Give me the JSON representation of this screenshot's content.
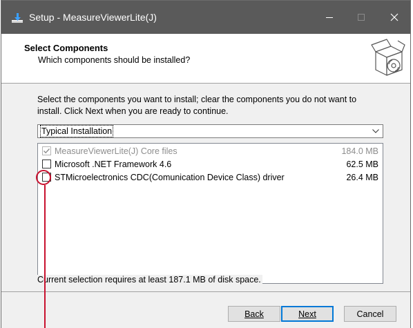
{
  "window": {
    "title": "Setup - MeasureViewerLite(J)",
    "icons": {
      "app": "installer-icon",
      "minimize": "minimize-icon",
      "maximize": "maximize-icon",
      "close": "close-icon"
    }
  },
  "header": {
    "title": "Select Components",
    "subtitle": "Which components should be installed?",
    "art": "software-box-icon"
  },
  "instructions": "Select the components you want to install; clear the components you do not want to install. Click Next when you are ready to continue.",
  "install_type": {
    "selected": "Typical Installation"
  },
  "components": [
    {
      "label": "MeasureViewerLite(J) Core files",
      "size": "184.0 MB",
      "checked": true,
      "disabled": true
    },
    {
      "label": "Microsoft .NET Framework 4.6",
      "size": "62.5 MB",
      "checked": false,
      "disabled": false
    },
    {
      "label": "STMicroelectronics CDC(Comunication Device Class) driver",
      "size": "26.4 MB",
      "checked": false,
      "disabled": false
    }
  ],
  "space_required": "Current selection requires at least 187.1 MB of disk space.",
  "buttons": {
    "back": "Back",
    "next": "Next",
    "cancel": "Cancel"
  },
  "colors": {
    "titlebar": "#5a5a5a",
    "annotation": "#c8102e",
    "default_button_border": "#0078d7"
  }
}
